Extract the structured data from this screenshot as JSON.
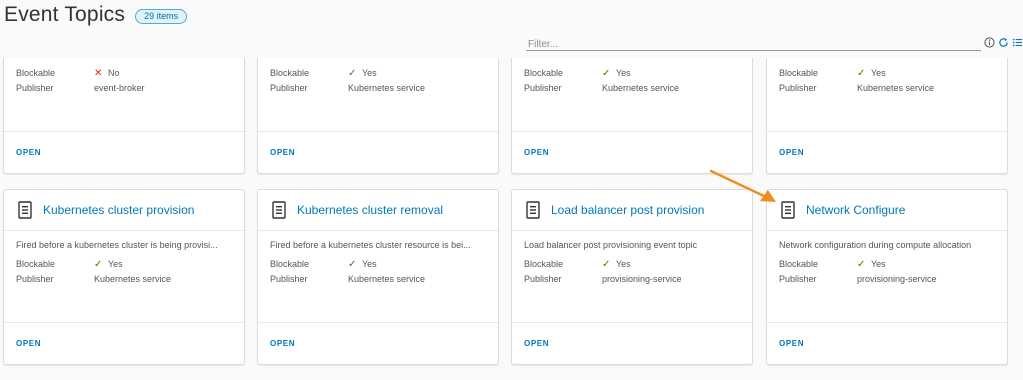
{
  "header": {
    "title": "Event Topics",
    "count_badge": "29 items"
  },
  "filter": {
    "placeholder": "Filter..."
  },
  "toolbar": {
    "icons": [
      "info-icon",
      "refresh-icon",
      "list-view-icon"
    ]
  },
  "labels": {
    "blockable": "Blockable",
    "publisher": "Publisher",
    "open": "OPEN"
  },
  "colors": {
    "accent": "#0079b8",
    "yes": "#2f8400",
    "no": "#e62700",
    "annotation_arrow": "#f08c1e"
  },
  "cards_top": [
    {
      "blockable": "No",
      "blockable_mark": "✕",
      "publisher": "event-broker"
    },
    {
      "blockable": "Yes",
      "blockable_mark": "✓",
      "publisher": "Kubernetes service"
    },
    {
      "blockable": "Yes",
      "blockable_mark": "✓",
      "publisher": "Kubernetes service"
    },
    {
      "blockable": "Yes",
      "blockable_mark": "✓",
      "publisher": "Kubernetes service"
    }
  ],
  "cards_bottom": [
    {
      "title": "Kubernetes cluster provision",
      "description": "Fired before a kubernetes cluster is being provisi...",
      "blockable": "Yes",
      "blockable_mark": "✓",
      "publisher": "Kubernetes service"
    },
    {
      "title": "Kubernetes cluster removal",
      "description": "Fired before a kubernetes cluster resource is bei...",
      "blockable": "Yes",
      "blockable_mark": "✓",
      "publisher": "Kubernetes service"
    },
    {
      "title": "Load balancer post provision",
      "description": "Load balancer post provisioning event topic",
      "blockable": "Yes",
      "blockable_mark": "✓",
      "publisher": "provisioning-service"
    },
    {
      "title": "Network Configure",
      "description": "Network configuration during compute allocation",
      "blockable": "Yes",
      "blockable_mark": "✓",
      "publisher": "provisioning-service"
    }
  ]
}
